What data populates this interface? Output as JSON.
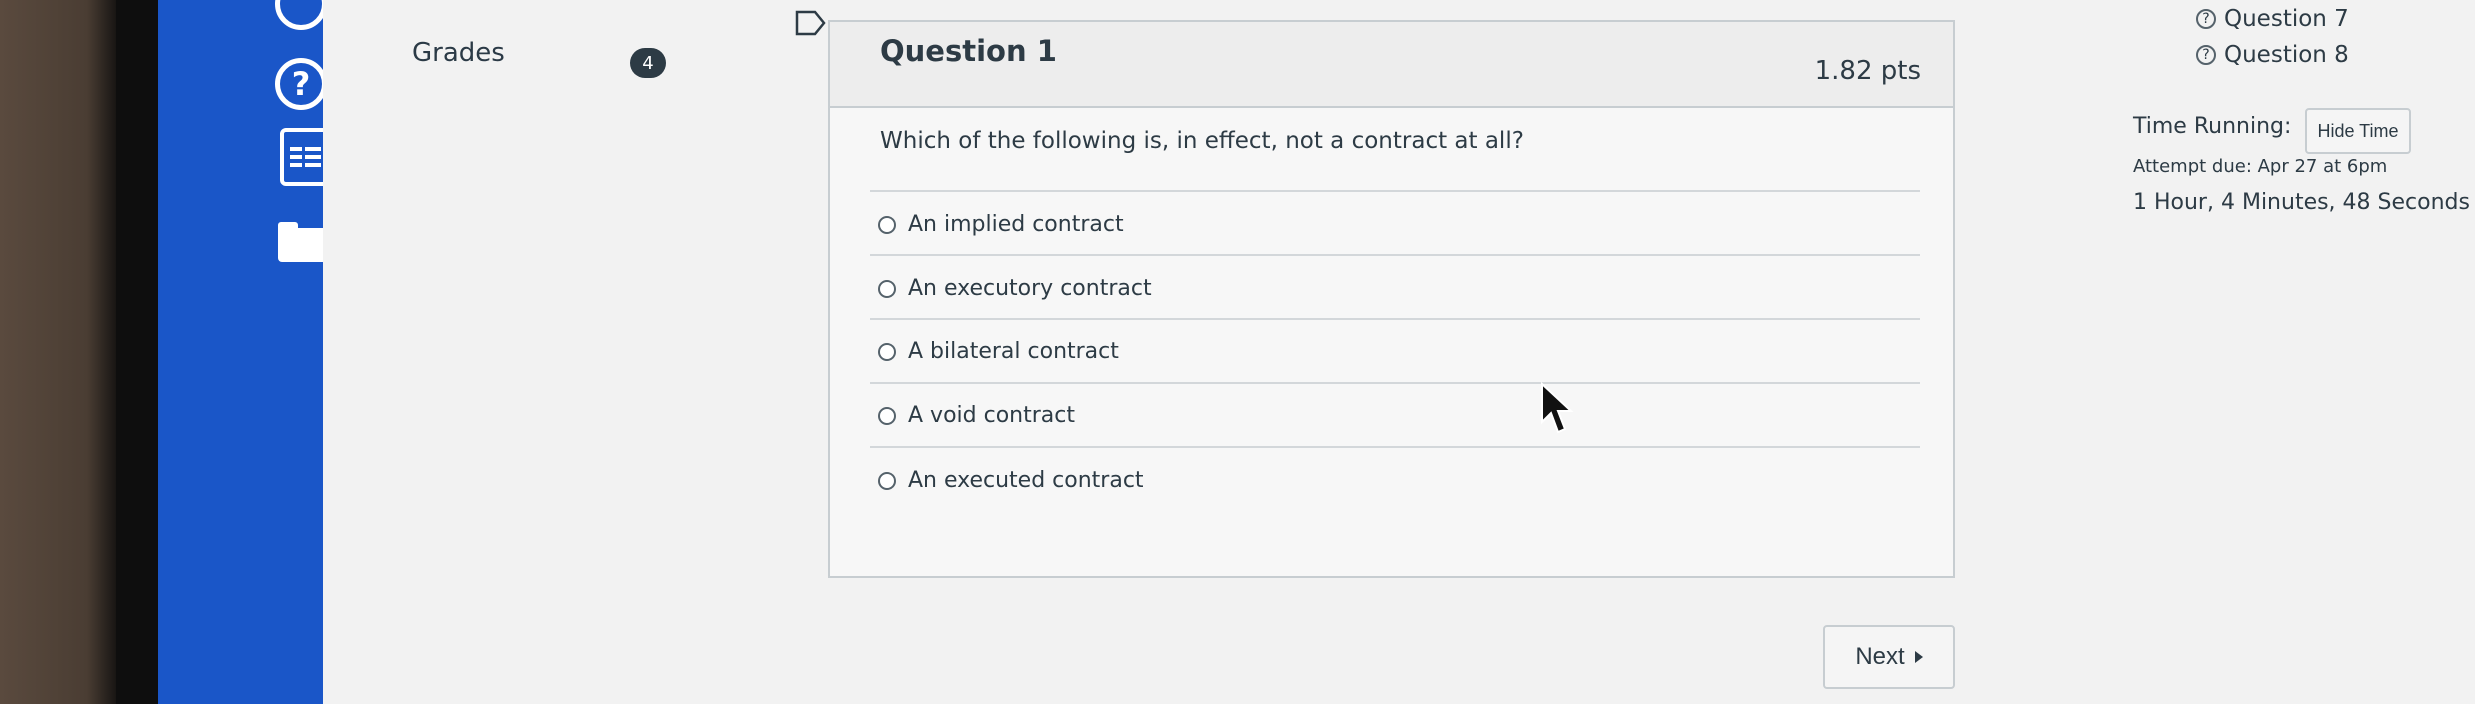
{
  "sidebar": {
    "icons": [
      "clock-icon",
      "help-icon",
      "inbox-icon",
      "folder-icon"
    ],
    "color": "#1a56c8"
  },
  "course_nav": {
    "grades_label": "Grades",
    "grades_badge": "4"
  },
  "question": {
    "title": "Question 1",
    "points": "1.82 pts",
    "text": "Which of the following is, in effect, not a contract at all?",
    "options": [
      "An implied contract",
      "An executory contract",
      "A bilateral contract",
      "A void contract",
      "An executed contract"
    ]
  },
  "footer": {
    "next_label": "Next"
  },
  "question_nav": {
    "items": [
      "Question 7",
      "Question 8"
    ]
  },
  "timer": {
    "label": "Time Running:",
    "hide_button": "Hide Time",
    "attempt_due": "Attempt due: Apr 27 at 6pm",
    "remaining": "1 Hour, 4 Minutes, 48 Seconds"
  }
}
